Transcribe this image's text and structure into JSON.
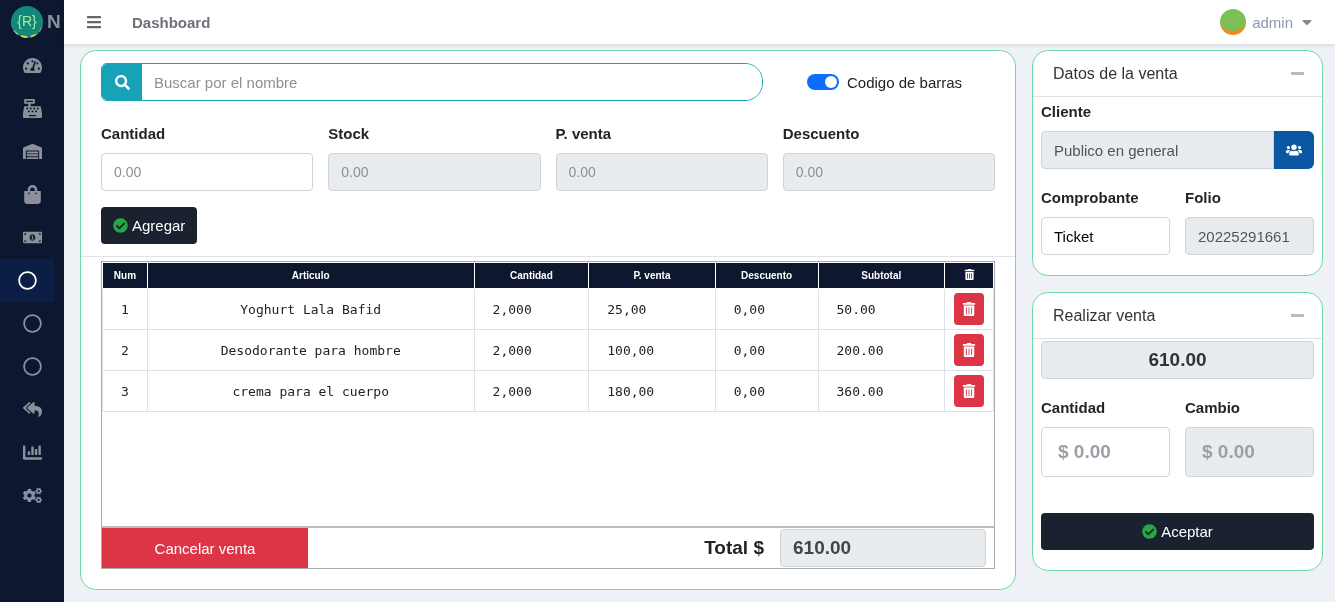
{
  "brand": {
    "logo": "{R}",
    "name": "N"
  },
  "sidebar": {
    "items": [
      {
        "selected": false
      },
      {
        "selected": false
      },
      {
        "selected": false
      },
      {
        "selected": false
      },
      {
        "selected": false
      },
      {
        "selected": true
      },
      {
        "selected": false
      },
      {
        "selected": false
      },
      {
        "selected": false
      },
      {
        "selected": false
      },
      {
        "selected": false
      }
    ]
  },
  "topbar": {
    "title": "Dashboard",
    "user": "admin"
  },
  "search": {
    "placeholder": "Buscar por el nombre"
  },
  "barcode_toggle": {
    "label": "Codigo de barras",
    "on": true
  },
  "fields": [
    {
      "label": "Cantidad",
      "placeholder": "0.00",
      "disabled": false
    },
    {
      "label": "Stock",
      "placeholder": "0.00",
      "disabled": true
    },
    {
      "label": "P. venta",
      "placeholder": "0.00",
      "disabled": true
    },
    {
      "label": "Descuento",
      "placeholder": "0.00",
      "disabled": true
    }
  ],
  "add_button": "Agregar",
  "table": {
    "columns": [
      "Num",
      "Articulo",
      "Cantidad",
      "P. venta",
      "Descuento",
      "Subtotal"
    ],
    "rows": [
      [
        "1",
        "Yoghurt Lala Bafid",
        "2,000",
        "25,00",
        "0,00",
        "50.00"
      ],
      [
        "2",
        "Desodorante para hombre",
        "2,000",
        "100,00",
        "0,00",
        "200.00"
      ],
      [
        "3",
        "crema para el cuerpo",
        "2,000",
        "180,00",
        "0,00",
        "360.00"
      ]
    ]
  },
  "cancel_button": "Cancelar venta",
  "total": {
    "label": "Total $",
    "value": "610.00"
  },
  "sale_data": {
    "title": "Datos de la venta",
    "client_label": "Cliente",
    "client_value": "Publico en general",
    "voucher_label": "Comprobante",
    "voucher_value": "Ticket",
    "folio_label": "Folio",
    "folio_value": "20225291661"
  },
  "checkout": {
    "title": "Realizar venta",
    "total": "610.00",
    "amount_label": "Cantidad",
    "amount_placeholder": "$ 0.00",
    "change_label": "Cambio",
    "change_placeholder": "$ 0.00",
    "button": "Aceptar"
  }
}
